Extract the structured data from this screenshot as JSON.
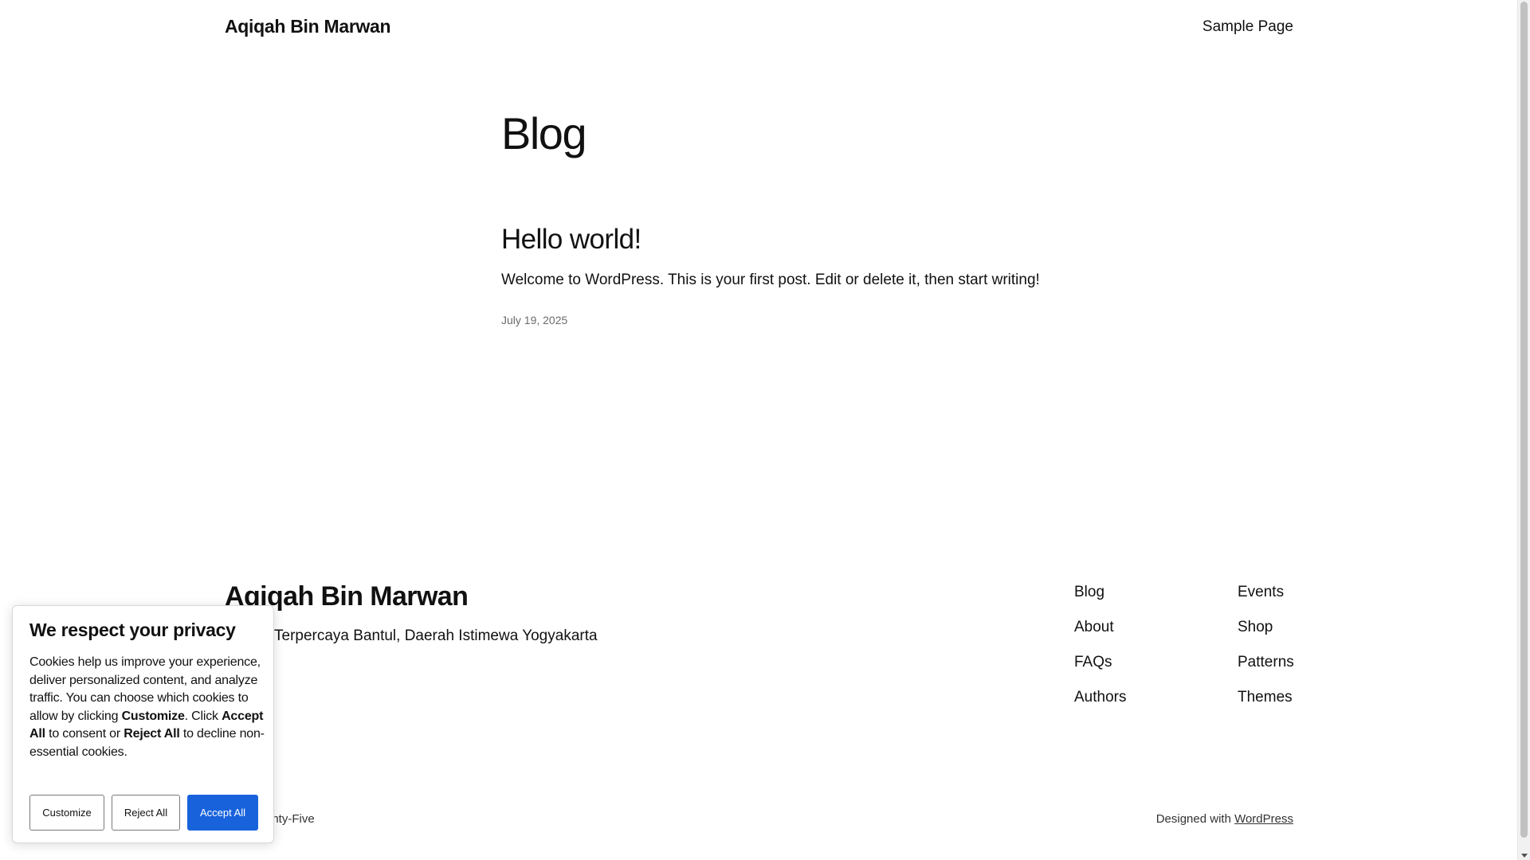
{
  "header": {
    "site_title": "Aqiqah Bin Marwan",
    "nav_sample_page": "Sample Page"
  },
  "main": {
    "page_heading": "Blog",
    "post": {
      "title": "Hello world!",
      "excerpt": "Welcome to WordPress. This is your first post. Edit or delete it, then start writing!",
      "date": "July 19, 2025"
    }
  },
  "footer": {
    "site_title": "Aqiqah Bin Marwan",
    "tagline_visible": "Terpercaya Bantul, Daerah Istimewa Yogyakarta",
    "nav_col_1": [
      "Blog",
      "About",
      "FAQs",
      "Authors"
    ],
    "nav_col_2": [
      "Events",
      "Shop",
      "Patterns",
      "Themes"
    ],
    "bottom_left_visible": "enty-Five",
    "designed_with": "Designed with",
    "wordpress_link": "WordPress"
  },
  "cookie_banner": {
    "title": "We respect your privacy",
    "text_part1": "Cookies help us improve your experience, deliver personalized content, and analyze traffic. You can choose which cookies to allow by clicking ",
    "text_customize": "Customize",
    "text_part2": ". Click ",
    "text_accept": "Accept All",
    "text_part3": " to consent or ",
    "text_reject": "Reject All",
    "text_part4": " to decline non-essential cookies.",
    "btn_customize": "Customize",
    "btn_reject": "Reject All",
    "btn_accept": "Accept All",
    "accent_color": "#1863dc"
  }
}
